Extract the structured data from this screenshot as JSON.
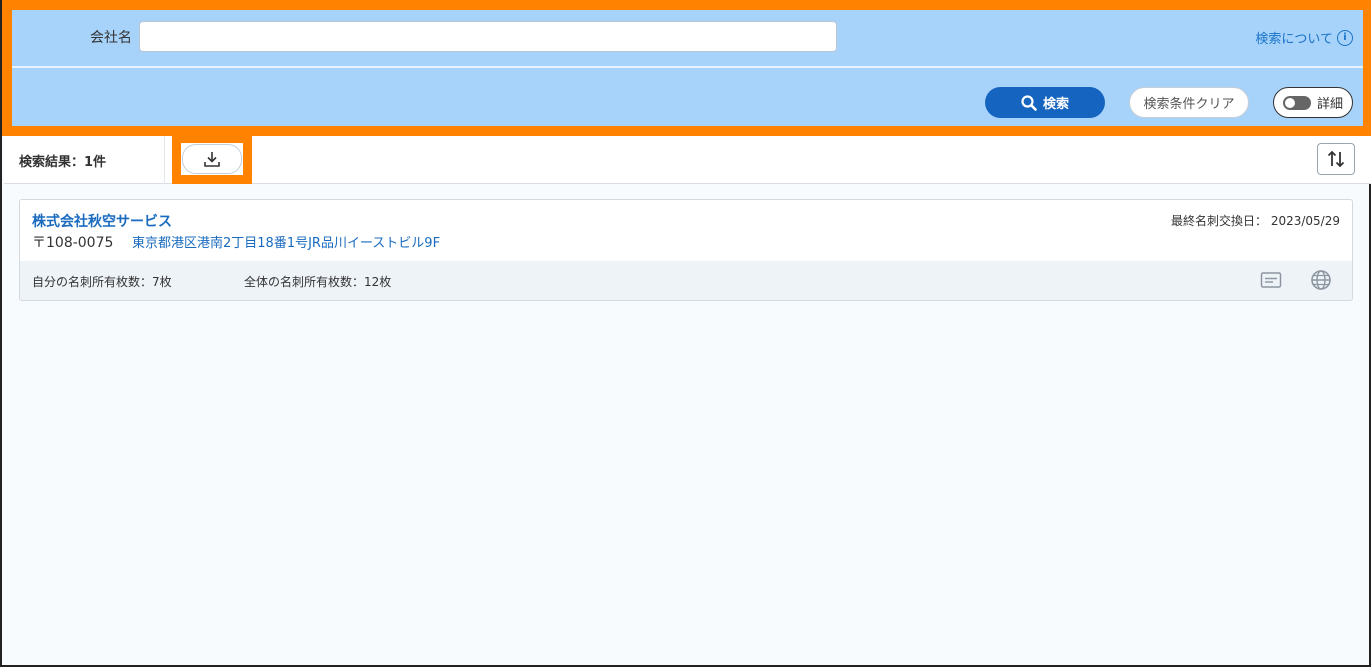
{
  "search": {
    "company_label": "会社名",
    "company_value": "",
    "company_placeholder": "",
    "about_link": "検索について",
    "search_button": "検索",
    "clear_button": "検索条件クリア",
    "detail_toggle": "詳細"
  },
  "results": {
    "count_label": "検索結果：1件"
  },
  "items": [
    {
      "company_name": "株式会社秋空サービス",
      "postal": "〒108-0075",
      "address": "東京都港区港南2丁目18番1号JR品川イーストビル9F",
      "last_exchange": "最終名刺交換日：  2023/05/29",
      "own_count": "自分の名刺所有枚数：7枚",
      "all_count": "全体の名刺所有枚数：12枚"
    }
  ],
  "colors": {
    "highlight": "#ff8200",
    "panel_bg": "#a7d3fb",
    "primary": "#1565c0",
    "link": "#1a6bbf"
  },
  "icons": {
    "info": "info-icon",
    "search": "search-icon",
    "download": "download-icon",
    "sort": "sort-icon",
    "card": "business-card-icon",
    "globe": "globe-icon"
  }
}
